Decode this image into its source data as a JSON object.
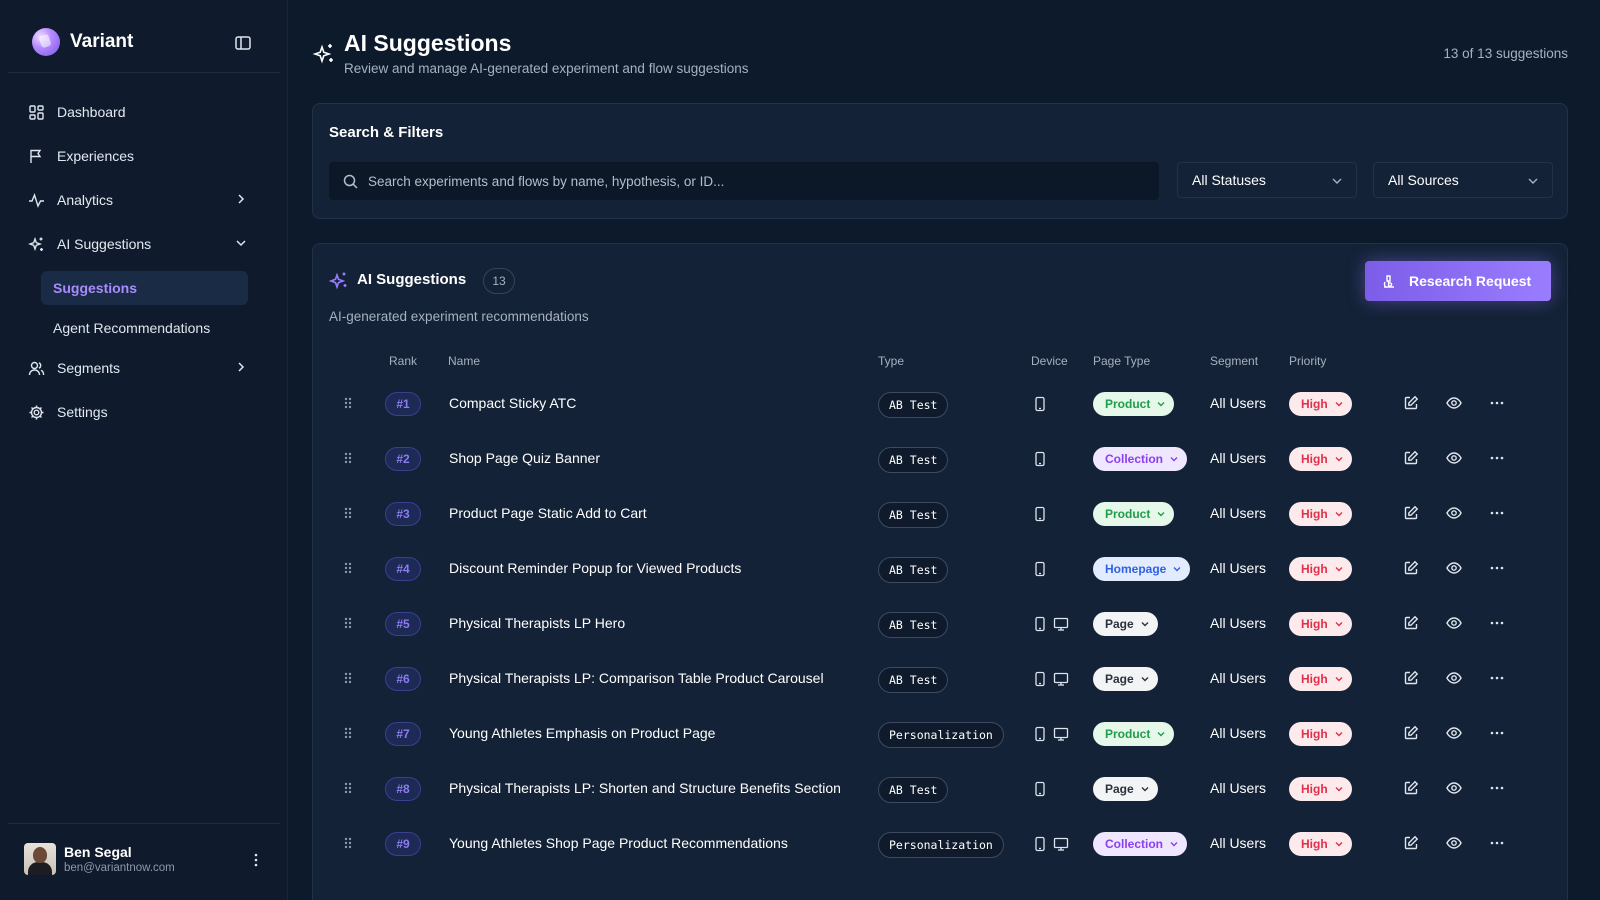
{
  "sidebar": {
    "brand": "Variant",
    "items": [
      {
        "label": "Dashboard"
      },
      {
        "label": "Experiences"
      },
      {
        "label": "Analytics"
      },
      {
        "label": "AI Suggestions"
      },
      {
        "label": "Segments"
      },
      {
        "label": "Settings"
      }
    ],
    "sub_items": [
      {
        "label": "Suggestions",
        "active": true
      },
      {
        "label": "Agent Recommendations",
        "active": false
      }
    ],
    "user": {
      "name": "Ben Segal",
      "email": "ben@variantnow.com"
    }
  },
  "header": {
    "title": "AI Suggestions",
    "subtitle": "Review and manage AI-generated experiment and flow suggestions",
    "count": "13 of 13 suggestions"
  },
  "filters": {
    "title": "Search & Filters",
    "search_placeholder": "Search experiments and flows by name, hypothesis, or ID...",
    "status": "All Statuses",
    "source": "All Sources"
  },
  "list": {
    "title": "AI Suggestions",
    "count": "13",
    "subtitle": "AI-generated experiment recommendations",
    "button": "Research Request",
    "columns": {
      "rank": "Rank",
      "name": "Name",
      "type": "Type",
      "device": "Device",
      "page_type": "Page Type",
      "segment": "Segment",
      "priority": "Priority"
    },
    "rows": [
      {
        "rank": "#1",
        "name": "Compact Sticky ATC",
        "type": "AB Test",
        "devices": [
          "mobile"
        ],
        "page_type": "Product",
        "segment": "All Users",
        "priority": "High"
      },
      {
        "rank": "#2",
        "name": "Shop Page Quiz Banner",
        "type": "AB Test",
        "devices": [
          "mobile"
        ],
        "page_type": "Collection",
        "segment": "All Users",
        "priority": "High"
      },
      {
        "rank": "#3",
        "name": "Product Page Static Add to Cart",
        "type": "AB Test",
        "devices": [
          "mobile"
        ],
        "page_type": "Product",
        "segment": "All Users",
        "priority": "High"
      },
      {
        "rank": "#4",
        "name": "Discount Reminder Popup for Viewed Products",
        "type": "AB Test",
        "devices": [
          "mobile"
        ],
        "page_type": "Homepage",
        "segment": "All Users",
        "priority": "High"
      },
      {
        "rank": "#5",
        "name": "Physical Therapists LP Hero",
        "type": "AB Test",
        "devices": [
          "mobile",
          "desktop"
        ],
        "page_type": "Page",
        "segment": "All Users",
        "priority": "High"
      },
      {
        "rank": "#6",
        "name": "Physical Therapists LP: Comparison Table Product Carousel",
        "type": "AB Test",
        "devices": [
          "mobile",
          "desktop"
        ],
        "page_type": "Page",
        "segment": "All Users",
        "priority": "High"
      },
      {
        "rank": "#7",
        "name": "Young Athletes Emphasis on Product Page",
        "type": "Personalization",
        "devices": [
          "mobile",
          "desktop"
        ],
        "page_type": "Product",
        "segment": "All Users",
        "priority": "High"
      },
      {
        "rank": "#8",
        "name": "Physical Therapists LP: Shorten and Structure Benefits Section",
        "type": "AB Test",
        "devices": [
          "mobile"
        ],
        "page_type": "Page",
        "segment": "All Users",
        "priority": "High"
      },
      {
        "rank": "#9",
        "name": "Young Athletes Shop Page Product Recommendations",
        "type": "Personalization",
        "devices": [
          "mobile",
          "desktop"
        ],
        "page_type": "Collection",
        "segment": "All Users",
        "priority": "High"
      }
    ]
  },
  "colors": {
    "accent": "#8b6cf0",
    "product_bg": "#e5f8ea",
    "product_fg": "#1f9d4a",
    "collection_bg": "#efe6ff",
    "collection_fg": "#8a3ff0",
    "homepage_bg": "#e3ecff",
    "homepage_fg": "#2f62e0",
    "page_bg": "#f3f4f6",
    "page_fg": "#2b313b",
    "priority_bg": "#fdeaec",
    "priority_fg": "#e0304a"
  }
}
